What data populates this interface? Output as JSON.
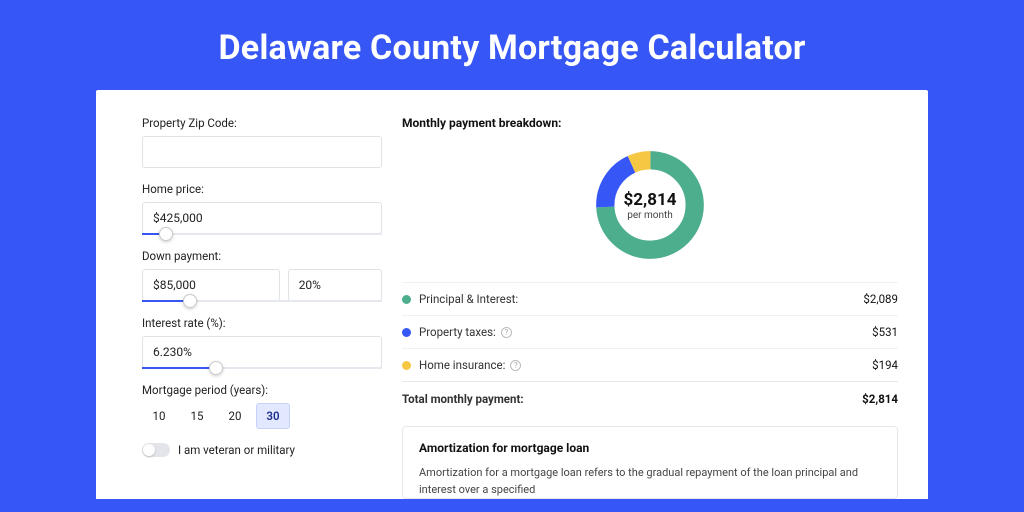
{
  "title": "Delaware County Mortgage Calculator",
  "left": {
    "zip_label": "Property Zip Code:",
    "zip_value": "",
    "price_label": "Home price:",
    "price_value": "$425,000",
    "price_slider_pct": 10,
    "down_label": "Down payment:",
    "down_amount": "$85,000",
    "down_pct": "20%",
    "down_slider_pct": 20,
    "rate_label": "Interest rate (%):",
    "rate_value": "6.230%",
    "rate_slider_pct": 31,
    "period_label": "Mortgage period (years):",
    "periods": [
      "10",
      "15",
      "20",
      "30"
    ],
    "period_active_index": 3,
    "veteran_label": "I am veteran or military"
  },
  "right": {
    "breakdown_title": "Monthly payment breakdown:",
    "center_amount": "$2,814",
    "center_sub": "per month",
    "rows": [
      {
        "label": "Principal & Interest:",
        "value": "$2,089",
        "info": false
      },
      {
        "label": "Property taxes:",
        "value": "$531",
        "info": true
      },
      {
        "label": "Home insurance:",
        "value": "$194",
        "info": true
      }
    ],
    "total_label": "Total monthly payment:",
    "total_value": "$2,814",
    "amort_title": "Amortization for mortgage loan",
    "amort_text": "Amortization for a mortgage loan refers to the gradual repayment of the loan principal and interest over a specified"
  },
  "chart_data": {
    "type": "pie",
    "title": "Monthly payment breakdown",
    "series": [
      {
        "name": "Principal & Interest",
        "value": 2089,
        "color": "#4cae8c"
      },
      {
        "name": "Property taxes",
        "value": 531,
        "color": "#3656f5"
      },
      {
        "name": "Home insurance",
        "value": 194,
        "color": "#f5c742"
      }
    ],
    "total": 2814
  }
}
